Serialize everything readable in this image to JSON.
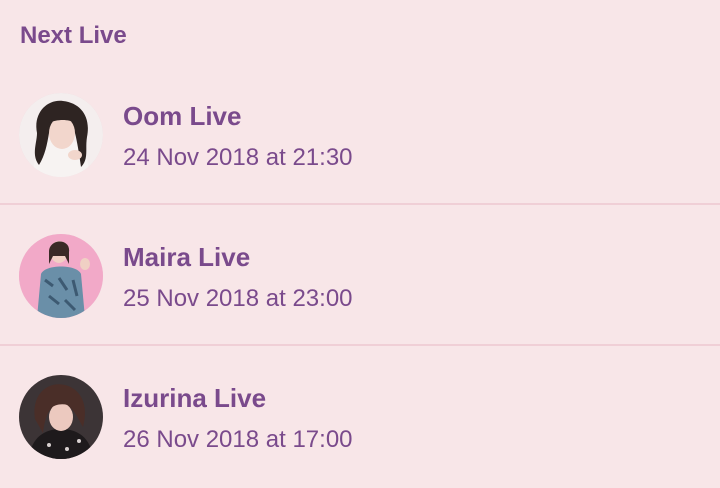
{
  "section": {
    "title": "Next Live"
  },
  "lives": [
    {
      "name": "Oom Live",
      "time": "24 Nov 2018 at 21:30",
      "avatar": "avatar-photo-oom"
    },
    {
      "name": "Maira Live",
      "time": "25 Nov 2018 at 23:00",
      "avatar": "avatar-photo-maira"
    },
    {
      "name": "Izurina Live",
      "time": "26 Nov 2018 at 17:00",
      "avatar": "avatar-photo-izurina"
    }
  ],
  "colors": {
    "background": "#f8e6e8",
    "accent": "#7a4a8c",
    "divider": "#f0cfd6"
  }
}
